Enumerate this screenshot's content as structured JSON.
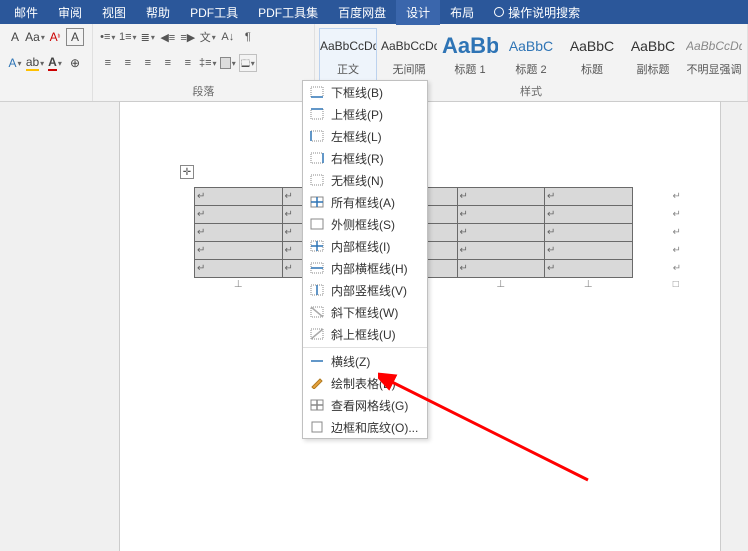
{
  "tabs": {
    "items": [
      "邮件",
      "审阅",
      "视图",
      "帮助",
      "PDF工具",
      "PDF工具集",
      "百度网盘",
      "设计",
      "布局"
    ],
    "active_index": 7,
    "search_hint": "操作说明搜索"
  },
  "paragraph_group_label": "段落",
  "styles_group_label": "样式",
  "styles": [
    {
      "preview": "AaBbCcDd",
      "name": "正文",
      "cls": "sel"
    },
    {
      "preview": "AaBbCcDd",
      "name": "无间隔"
    },
    {
      "preview": "AaBb",
      "name": "标题 1",
      "pcls": "big blue"
    },
    {
      "preview": "AaBbC",
      "name": "标题 2",
      "pcls": "mid blue"
    },
    {
      "preview": "AaBbC",
      "name": "标题",
      "pcls": "mid"
    },
    {
      "preview": "AaBbC",
      "name": "副标题",
      "pcls": "mid"
    },
    {
      "preview": "AaBbCcDd",
      "name": "不明显强调",
      "pcls": "ital"
    }
  ],
  "borders_menu": {
    "items": [
      {
        "icon": "bottom",
        "label": "下框线(B)"
      },
      {
        "icon": "top",
        "label": "上框线(P)"
      },
      {
        "icon": "left",
        "label": "左框线(L)"
      },
      {
        "icon": "right",
        "label": "右框线(R)"
      },
      {
        "icon": "none",
        "label": "无框线(N)"
      },
      {
        "icon": "all",
        "label": "所有框线(A)"
      },
      {
        "icon": "outside",
        "label": "外侧框线(S)"
      },
      {
        "icon": "inside",
        "label": "内部框线(I)"
      },
      {
        "icon": "inh",
        "label": "内部横框线(H)"
      },
      {
        "icon": "inv",
        "label": "内部竖框线(V)"
      },
      {
        "icon": "diagdn",
        "label": "斜下框线(W)"
      },
      {
        "icon": "diagup",
        "label": "斜上框线(U)"
      }
    ],
    "items2": [
      {
        "icon": "hline",
        "label": "横线(Z)"
      },
      {
        "icon": "draw",
        "label": "绘制表格(D)"
      },
      {
        "icon": "grid",
        "label": "查看网格线(G)"
      },
      {
        "icon": "dialog",
        "label": "边框和底纹(O)..."
      }
    ]
  },
  "table": {
    "rows": 5,
    "cols": 5,
    "cell_mark": "↵"
  },
  "canvas_cursor_mark": "✛"
}
